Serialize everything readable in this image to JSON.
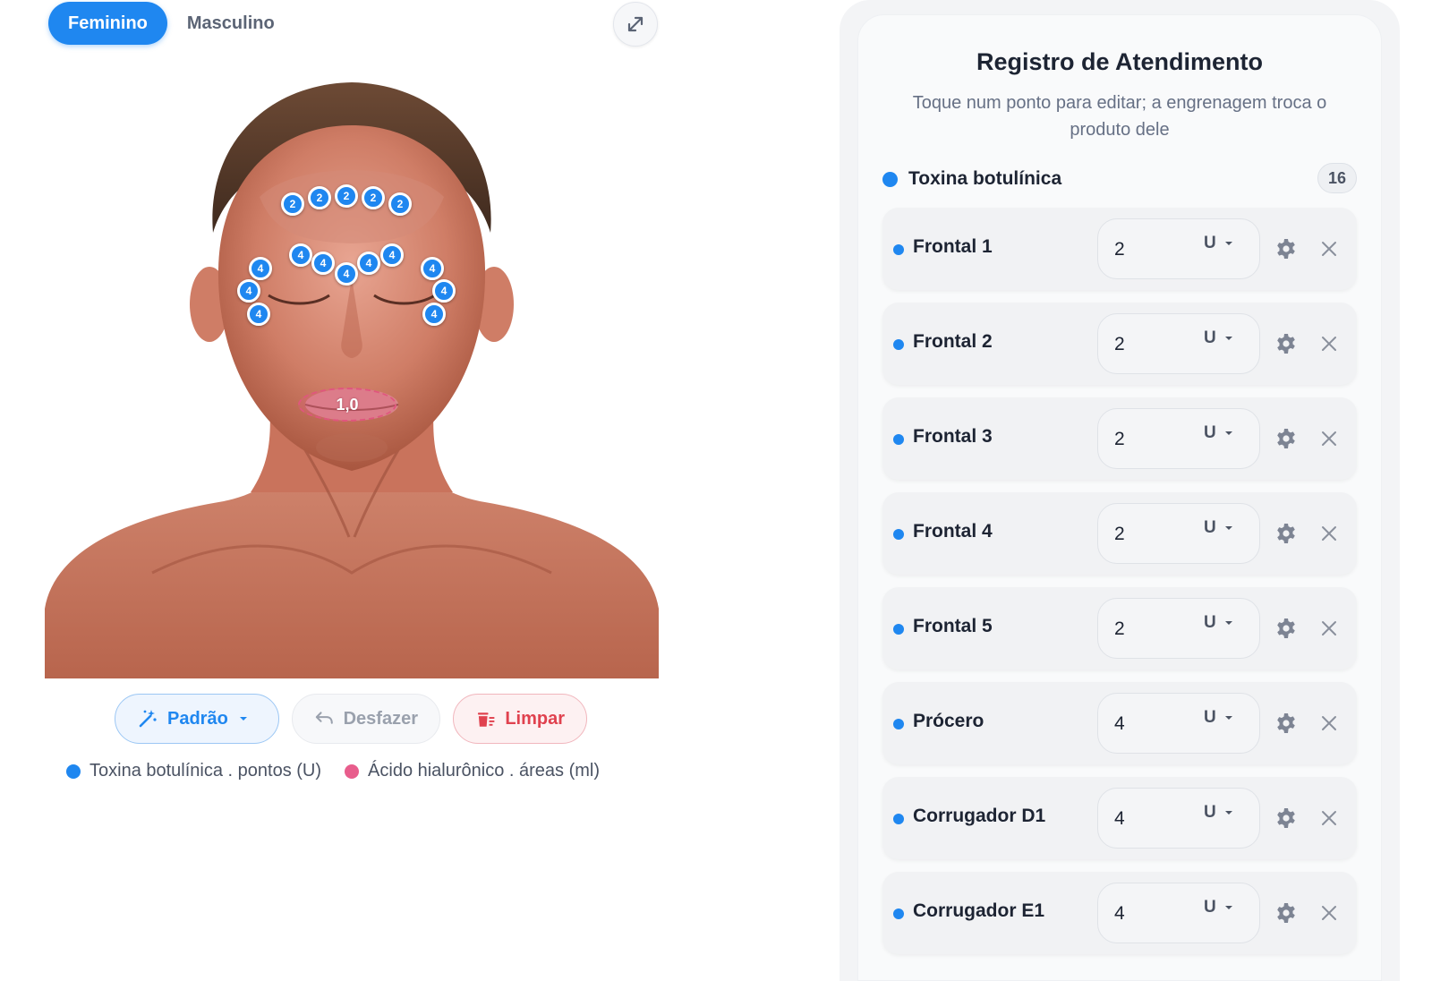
{
  "gender_toggle": {
    "female_label": "Feminino",
    "male_label": "Masculino"
  },
  "figure": {
    "botox_pins": [
      {
        "label": "2"
      },
      {
        "label": "2"
      },
      {
        "label": "2"
      },
      {
        "label": "2"
      },
      {
        "label": "2"
      },
      {
        "label": "4"
      },
      {
        "label": "4"
      },
      {
        "label": "4"
      },
      {
        "label": "4"
      },
      {
        "label": "4"
      },
      {
        "label": "4"
      },
      {
        "label": "4"
      },
      {
        "label": "4"
      },
      {
        "label": "4"
      },
      {
        "label": "4"
      },
      {
        "label": "4"
      }
    ],
    "lip_area_label": "1,0"
  },
  "toolbar": {
    "padrao_label": "Padrão",
    "desfazer_label": "Desfazer",
    "limpar_label": "Limpar"
  },
  "legend": {
    "botox_label": "Toxina botulínica . pontos (U)",
    "acido_label": "Ácido hialurônico . áreas (ml)"
  },
  "colors": {
    "accent": "#1f87f0",
    "pink": "#e85d8c",
    "danger": "#e0424f"
  },
  "panel": {
    "title": "Registro de Atendimento",
    "subtitle": "Toque num ponto para editar; a engrenagem troca o produto dele",
    "group": {
      "name": "Toxina botulínica",
      "count": "16"
    },
    "rows": [
      {
        "name": "Frontal 1",
        "value": "2",
        "unit": "U"
      },
      {
        "name": "Frontal 2",
        "value": "2",
        "unit": "U"
      },
      {
        "name": "Frontal 3",
        "value": "2",
        "unit": "U"
      },
      {
        "name": "Frontal 4",
        "value": "2",
        "unit": "U"
      },
      {
        "name": "Frontal 5",
        "value": "2",
        "unit": "U"
      },
      {
        "name": "Prócero",
        "value": "4",
        "unit": "U"
      },
      {
        "name": "Corrugador D1",
        "value": "4",
        "unit": "U"
      },
      {
        "name": "Corrugador E1",
        "value": "4",
        "unit": "U"
      }
    ]
  }
}
